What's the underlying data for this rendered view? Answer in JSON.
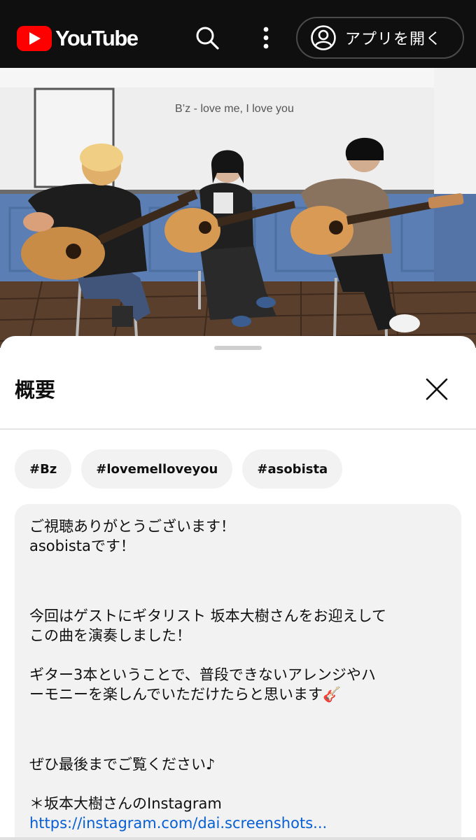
{
  "header": {
    "brand": "YouTube",
    "icons": [
      "youtube-logo-icon",
      "search-icon",
      "more-vert-icon",
      "account-icon"
    ],
    "open_app_label": "アプリを開く",
    "colors": {
      "bar": "#0f0f0f",
      "logo_red": "#ff0000"
    }
  },
  "video": {
    "caption": "B’z - love me, I love you"
  },
  "panel": {
    "title": "概要",
    "close_icon": "close-icon",
    "chips": [
      "#Bz",
      "#lovemelloveyou",
      "#asobista"
    ]
  },
  "description": {
    "lines": [
      "ご視聴ありがとうございます！",
      "asobistaです！",
      "今回はゲストにギタリスト 坂本大樹さんをお迎えして",
      "この曲を演奏しました！",
      "ギター3本ということで、普段できないアレンジやハ",
      "ーモニーを楽しんでいただけたらと思います🎸",
      "ぜひ最後までご覧ください♪",
      "＊坂本大樹さんのInstagram"
    ],
    "link": "https://instagram.com/dai.screenshots...",
    "link_color": "#065fd4"
  }
}
